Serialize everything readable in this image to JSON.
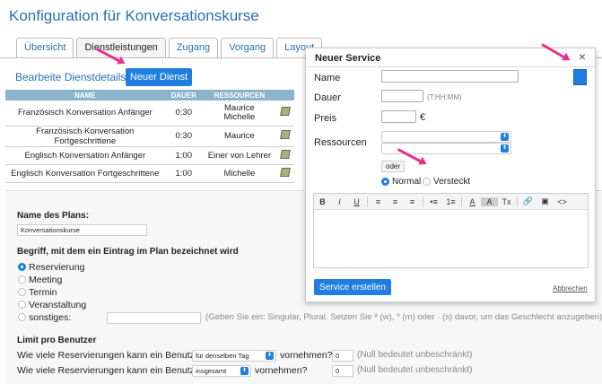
{
  "page": {
    "title": "Konfiguration für Konversationskurse"
  },
  "tabs": [
    {
      "label": "Übersicht"
    },
    {
      "label": "Dienstleistungen"
    },
    {
      "label": "Zugang"
    },
    {
      "label": "Vorgang"
    },
    {
      "label": "Layout"
    }
  ],
  "services": {
    "edit_link": "Bearbeite Dienstdetails",
    "new_button": "Neuer Dienst",
    "columns": [
      "NAME",
      "DAUER",
      "RESSOURCEN"
    ],
    "rows": [
      {
        "name": "Französisch Konversation Anfänger",
        "duration": "0:30",
        "resources": "Maurice Michelle"
      },
      {
        "name": "Französisch Konversation Fortgeschrittene",
        "duration": "0:30",
        "resources": "Maurice"
      },
      {
        "name": "Englisch Konversation Anfänger",
        "duration": "1:00",
        "resources": "Einer von Lehrer"
      },
      {
        "name": "Englisch Konversation Fortgeschrittene",
        "duration": "1:00",
        "resources": "Michelle"
      }
    ]
  },
  "plan": {
    "name_label": "Name des Plans:",
    "name_value": "Konversationskurse",
    "term_label": "Begriff, mit dem ein Eintrag im Plan bezeichnet wird",
    "options": [
      "Reservierung",
      "Meeting",
      "Termin",
      "Veranstaltung",
      "sonstiges:"
    ],
    "other_hint": "(Geben Sie ein: Singular, Plural. Setzen Sie ª (w), º (m) oder · (s) davor, um das Geschlecht anzugeben)",
    "limit_heading": "Limit pro Benutzer",
    "limit_question_prefix": "Wie viele Reservierungen kann ein Benutzer",
    "limit_question_suffix": "vornehmen?",
    "limit1_select": "für denselben Tag",
    "limit2_select": "insgesamt",
    "limit1_value": "0",
    "limit2_value": "0",
    "limit_hint": "(Null bedeutet unbeschränkt)"
  },
  "modal": {
    "title": "Neuer Service",
    "close": "×",
    "name_label": "Name",
    "duration_label": "Dauer",
    "duration_hint": "(T:HH:MM)",
    "price_label": "Preis",
    "currency": "€",
    "resources_label": "Ressourcen",
    "or_button": "oder",
    "visibility_normal": "Normal",
    "visibility_hidden": "Versteckt",
    "toolbar": [
      "B",
      "I",
      "U",
      "≡",
      "≡",
      "≡",
      "•≡",
      "1≡",
      "A",
      "A",
      "Tx",
      "🔗",
      "▣",
      "<>"
    ],
    "create_button": "Service erstellen",
    "cancel_link": "Abbrechen"
  },
  "colors": {
    "accent": "#1f7ee0",
    "title": "#2a6fb5",
    "annotation_arrow": "#e8318c",
    "table_header": "#8cb3cc"
  }
}
